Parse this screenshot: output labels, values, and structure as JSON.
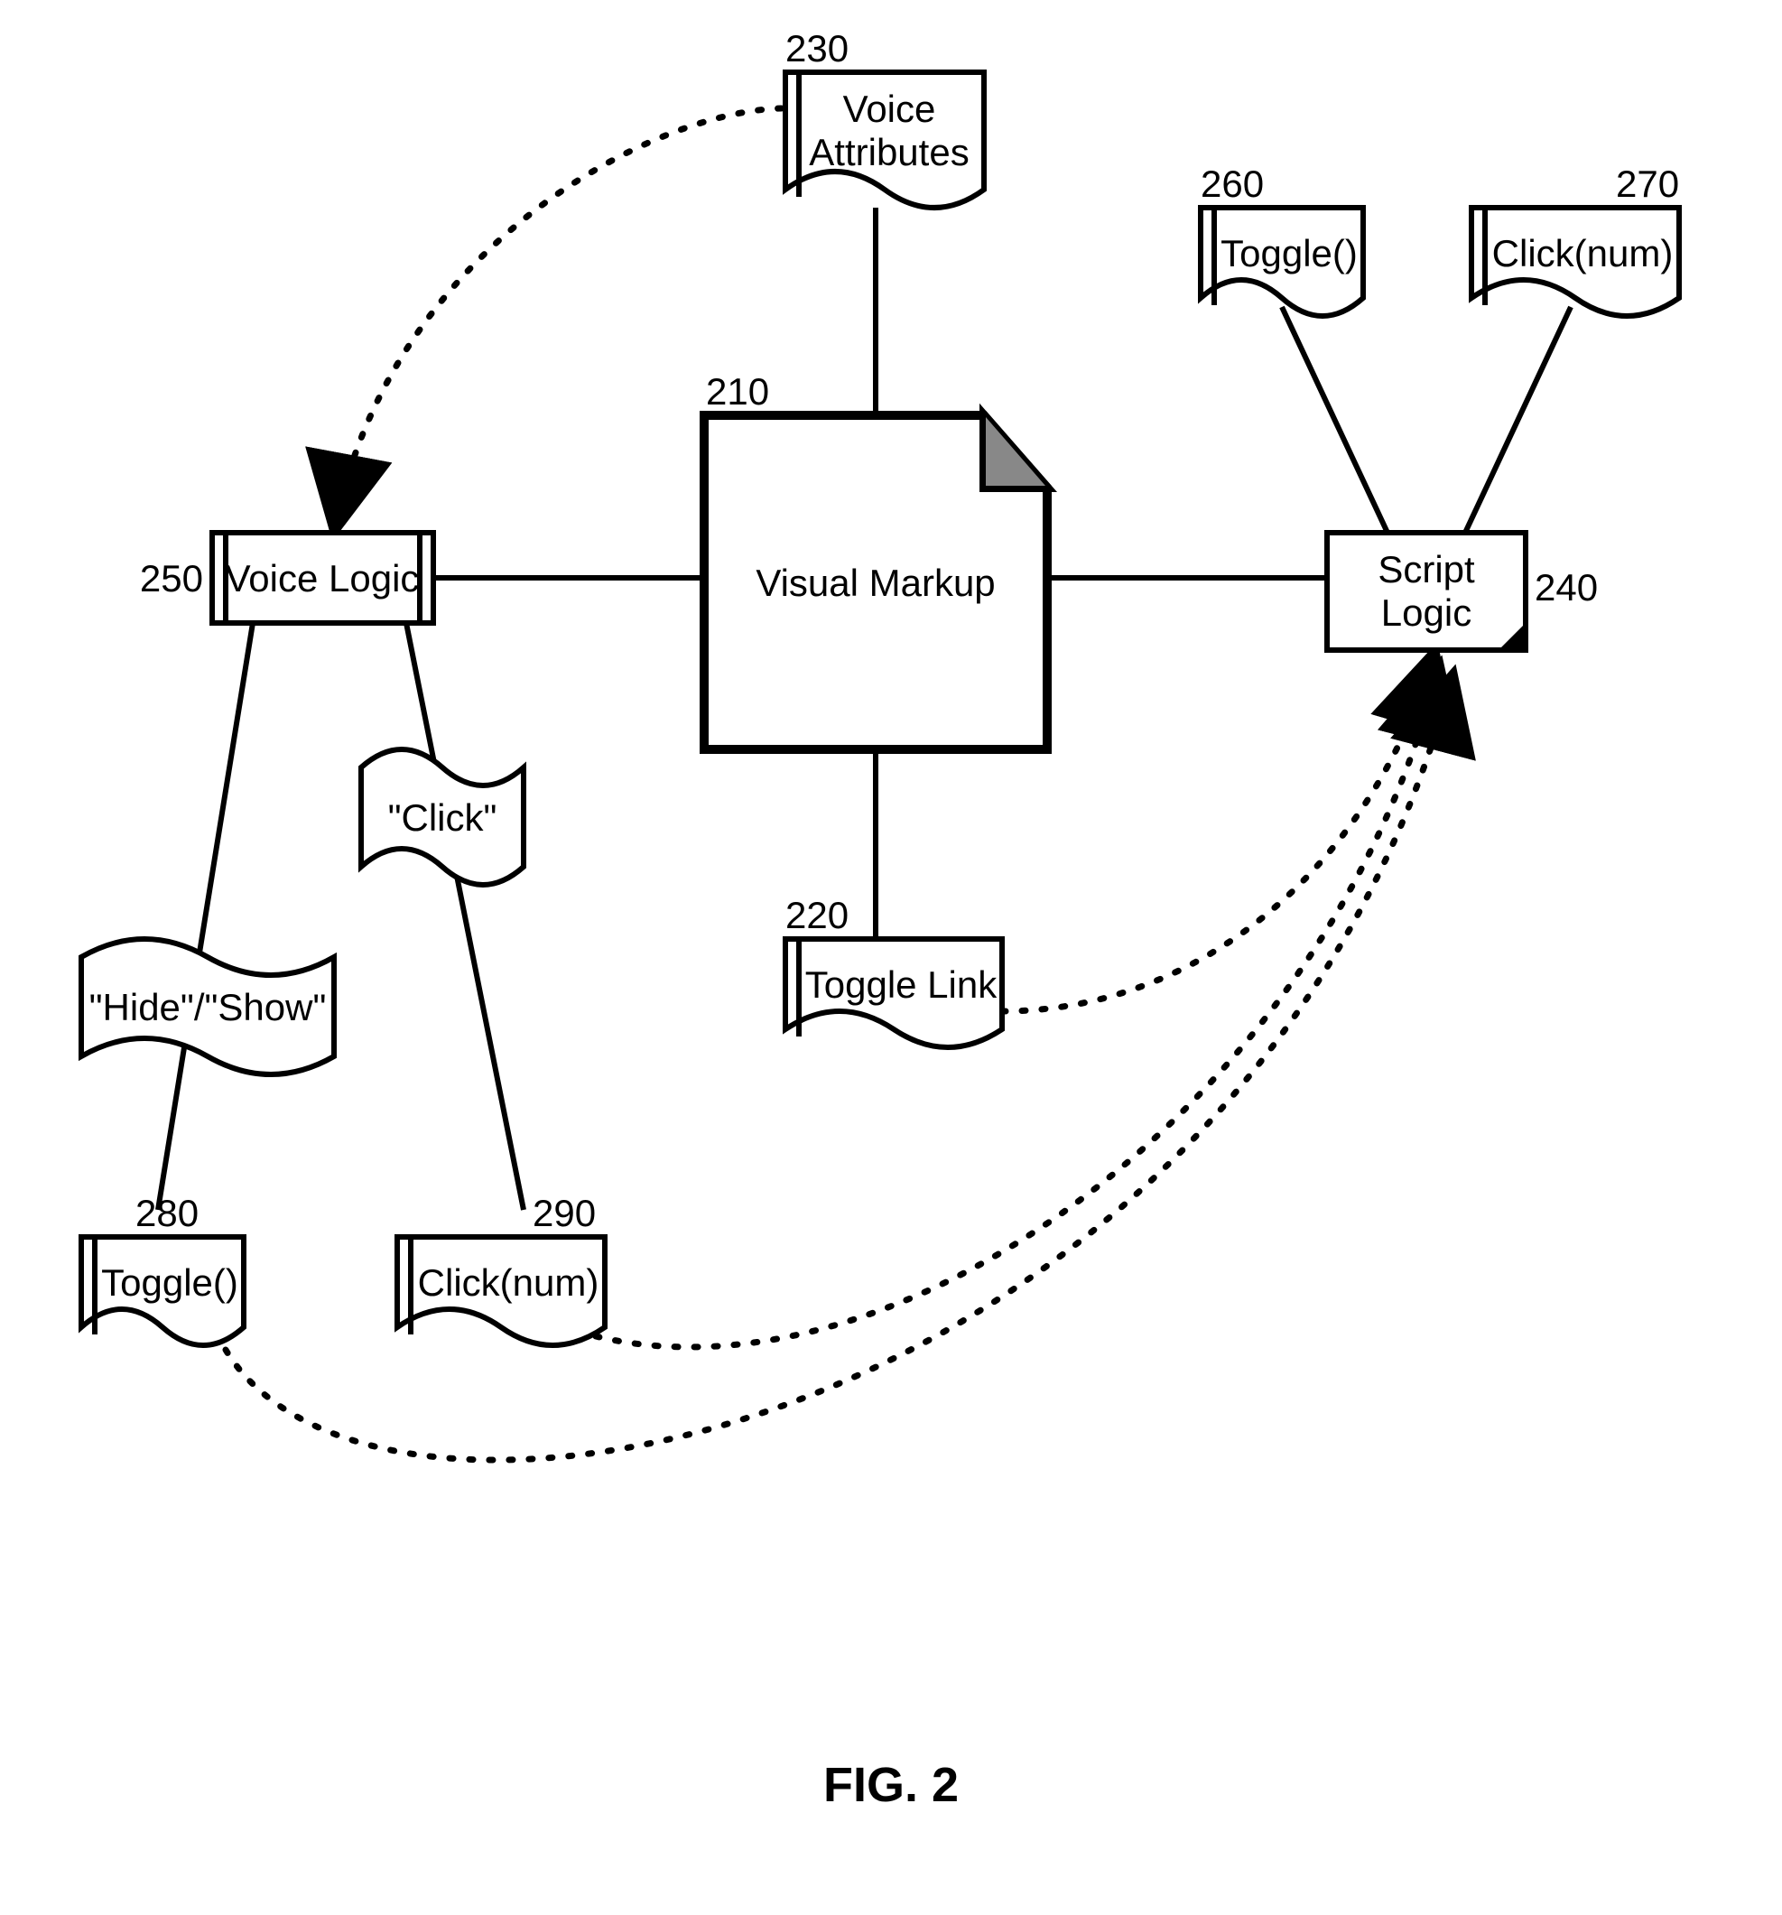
{
  "figure_label": "FIG. 2",
  "nodes": {
    "visual_markup": {
      "num": "210",
      "label": "Visual Markup"
    },
    "toggle_link": {
      "num": "220",
      "label": "Toggle Link"
    },
    "voice_attributes": {
      "num": "230",
      "label": "Voice\nAttributes"
    },
    "script_logic": {
      "num": "240",
      "label": "Script\nLogic"
    },
    "voice_logic": {
      "num": "250",
      "label": "Voice Logic"
    },
    "toggle_fn_a": {
      "num": "260",
      "label": "Toggle()"
    },
    "click_fn_a": {
      "num": "270",
      "label": "Click(num)"
    },
    "toggle_fn_b": {
      "num": "280",
      "label": "Toggle()"
    },
    "click_fn_b": {
      "num": "290",
      "label": "Click(num)"
    }
  },
  "flags": {
    "hide_show": "\"Hide\"/\"Show\"",
    "click": "\"Click\""
  }
}
